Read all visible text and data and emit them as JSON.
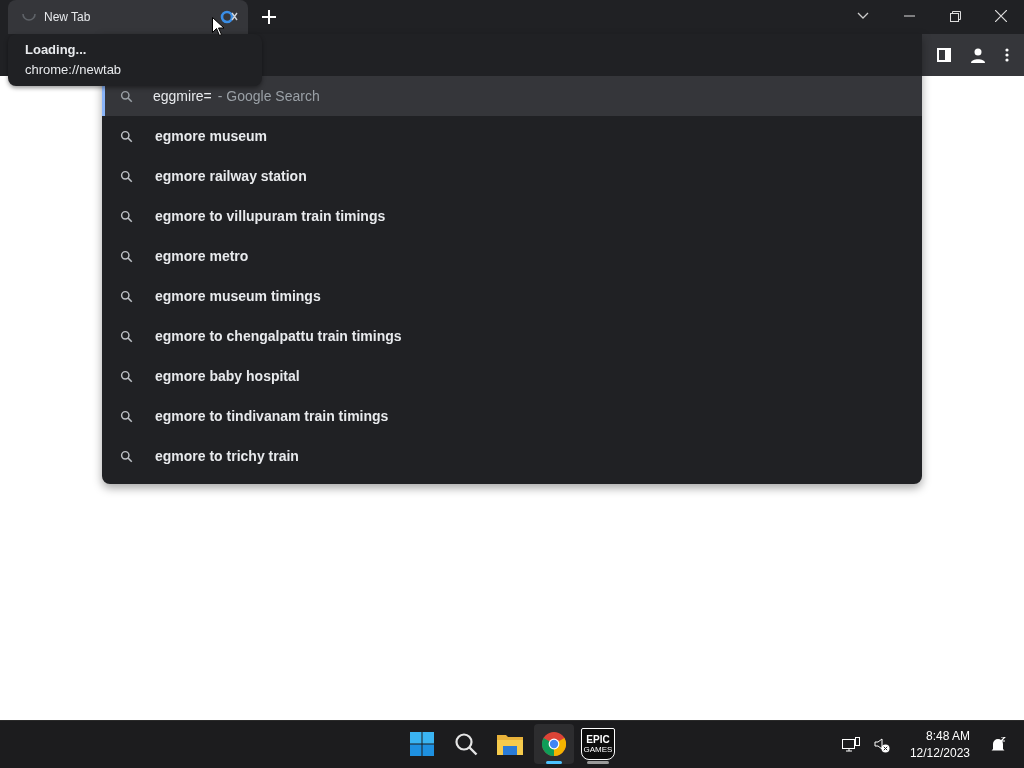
{
  "tab": {
    "title": "New Tab"
  },
  "tooltip": {
    "title": "Loading...",
    "url": "chrome://newtab"
  },
  "omnibox": {
    "value": "eggmire=",
    "hint": "- Google Search"
  },
  "suggestions": [
    {
      "text": "egmore museum"
    },
    {
      "text": "egmore railway station"
    },
    {
      "text": "egmore to villupuram train timings"
    },
    {
      "text": "egmore metro"
    },
    {
      "text": "egmore museum timings"
    },
    {
      "text": "egmore to chengalpattu train timings"
    },
    {
      "text": "egmore baby hospital"
    },
    {
      "text": "egmore to tindivanam train timings"
    },
    {
      "text": "egmore to trichy train"
    }
  ],
  "taskbar": {
    "apps": [
      {
        "kind": "start",
        "selected": false,
        "running": false
      },
      {
        "kind": "search",
        "selected": false,
        "running": false
      },
      {
        "kind": "files",
        "selected": false,
        "running": false
      },
      {
        "kind": "browser",
        "selected": true,
        "running": true
      },
      {
        "kind": "epic",
        "selected": false,
        "running": true,
        "logo_text": "EPIC",
        "logo_subtext": "GAMES"
      }
    ]
  },
  "clock": {
    "time": "8:48 AM",
    "date": "12/12/2023"
  }
}
